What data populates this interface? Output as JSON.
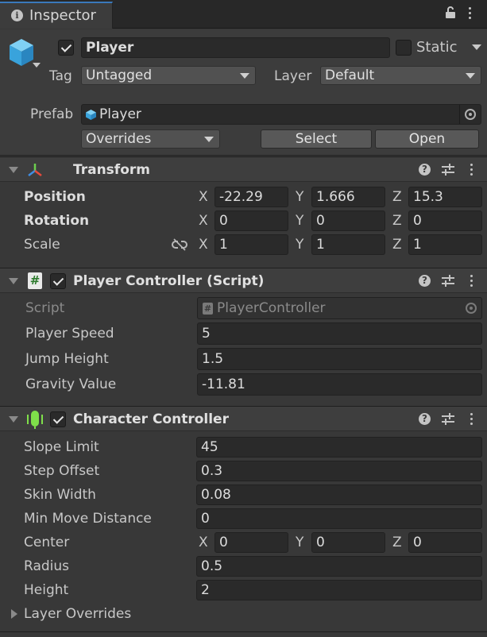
{
  "tab": {
    "title": "Inspector",
    "icon": "info-icon"
  },
  "header": {
    "checked": true,
    "name": "Player",
    "static_label": "Static",
    "tag_label": "Tag",
    "tag_value": "Untagged",
    "layer_label": "Layer",
    "layer_value": "Default",
    "prefab_label": "Prefab",
    "prefab_value": "Player",
    "overrides_label": "Overrides",
    "select_label": "Select",
    "open_label": "Open"
  },
  "transform": {
    "title": "Transform",
    "rows": [
      {
        "label": "Position",
        "x": "-22.29",
        "y": "1.666",
        "z": "15.3"
      },
      {
        "label": "Rotation",
        "x": "0",
        "y": "0",
        "z": "0"
      },
      {
        "label": "Scale",
        "x": "1",
        "y": "1",
        "z": "1"
      }
    ],
    "axes": {
      "x": "X",
      "y": "Y",
      "z": "Z"
    }
  },
  "player_controller": {
    "title": "Player Controller (Script)",
    "script_label": "Script",
    "script_value": "PlayerController",
    "fields": [
      {
        "label": "Player Speed",
        "value": "5"
      },
      {
        "label": "Jump Height",
        "value": "1.5"
      },
      {
        "label": "Gravity Value",
        "value": "-11.81"
      }
    ]
  },
  "character_controller": {
    "title": "Character Controller",
    "fields": [
      {
        "label": "Slope Limit",
        "value": "45"
      },
      {
        "label": "Step Offset",
        "value": "0.3"
      },
      {
        "label": "Skin Width",
        "value": "0.08"
      },
      {
        "label": "Min Move Distance",
        "value": "0"
      }
    ],
    "center": {
      "label": "Center",
      "x": "0",
      "y": "0",
      "z": "0"
    },
    "fields2": [
      {
        "label": "Radius",
        "value": "0.5"
      },
      {
        "label": "Height",
        "value": "2"
      }
    ],
    "layer_overrides_label": "Layer Overrides"
  }
}
